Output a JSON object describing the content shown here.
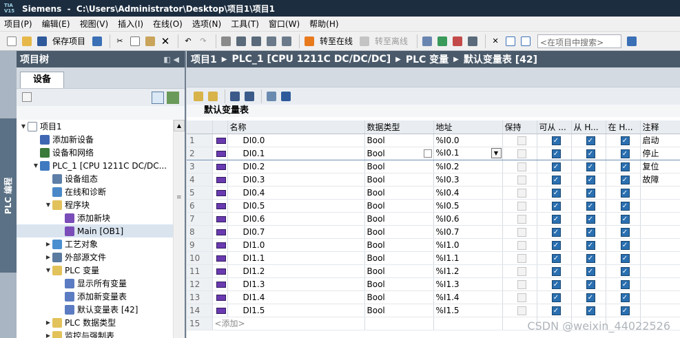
{
  "window": {
    "logo": "TIA\nV15",
    "title": "Siemens  -  C:\\Users\\Administrator\\Desktop\\项目1\\项目1"
  },
  "menu": [
    "项目(P)",
    "编辑(E)",
    "视图(V)",
    "插入(I)",
    "在线(O)",
    "选项(N)",
    "工具(T)",
    "窗口(W)",
    "帮助(H)"
  ],
  "toolbar": {
    "save_project": "保存项目",
    "go_online": "转至在线",
    "go_offline": "转至离线",
    "search_placeholder": "<在项目中搜索>"
  },
  "sidetab_label": "PLC 编程",
  "project_tree": {
    "title": "项目树",
    "device_tab": "设备",
    "items": [
      {
        "label": "项目1",
        "level": 0,
        "expander": "open",
        "icon": "project-icon",
        "color": "#ffffff"
      },
      {
        "label": "添加新设备",
        "level": 1,
        "expander": "",
        "icon": "add-device-icon",
        "color": "#3e66b3"
      },
      {
        "label": "设备和网络",
        "level": 1,
        "expander": "",
        "icon": "network-icon",
        "color": "#3a7a3a"
      },
      {
        "label": "PLC_1 [CPU 1211C DC/DC...",
        "level": 1,
        "expander": "open",
        "icon": "plc-icon",
        "color": "#3f7ac0"
      },
      {
        "label": "设备组态",
        "level": 2,
        "expander": "",
        "icon": "device-config-icon",
        "color": "#5d7ea6"
      },
      {
        "label": "在线和诊断",
        "level": 2,
        "expander": "",
        "icon": "diagnostics-icon",
        "color": "#4a88c7"
      },
      {
        "label": "程序块",
        "level": 2,
        "expander": "open",
        "icon": "folder-icon",
        "color": "#e2c25a"
      },
      {
        "label": "添加新块",
        "level": 3,
        "expander": "",
        "icon": "add-block-icon",
        "color": "#7a4db8"
      },
      {
        "label": "Main [OB1]",
        "level": 3,
        "expander": "",
        "icon": "ob-block-icon",
        "color": "#7a4db8"
      },
      {
        "label": "工艺对象",
        "level": 2,
        "expander": "closed",
        "icon": "technology-object-icon",
        "color": "#4b8fd0"
      },
      {
        "label": "外部源文件",
        "level": 2,
        "expander": "closed",
        "icon": "external-source-icon",
        "color": "#5a7aa0"
      },
      {
        "label": "PLC 变量",
        "level": 2,
        "expander": "open",
        "icon": "plc-tags-folder-icon",
        "color": "#e2c25a"
      },
      {
        "label": "显示所有变量",
        "level": 3,
        "expander": "",
        "icon": "tag-table-icon",
        "color": "#5b7cc2"
      },
      {
        "label": "添加新变量表",
        "level": 3,
        "expander": "",
        "icon": "add-tag-table-icon",
        "color": "#5b7cc2"
      },
      {
        "label": "默认变量表 [42]",
        "level": 3,
        "expander": "",
        "icon": "tag-table-icon",
        "color": "#5b7cc2"
      },
      {
        "label": "PLC 数据类型",
        "level": 2,
        "expander": "closed",
        "icon": "datatype-folder-icon",
        "color": "#e2c25a"
      },
      {
        "label": "监控与强制表",
        "level": 2,
        "expander": "closed",
        "icon": "watch-table-folder-icon",
        "color": "#e2c25a"
      }
    ]
  },
  "breadcrumb": [
    "项目1",
    "PLC_1 [CPU 1211C DC/DC/DC]",
    "PLC 变量",
    "默认变量表 [42]"
  ],
  "tag_table": {
    "title": "默认变量表",
    "columns": [
      "",
      "",
      "名称",
      "数据类型",
      "地址",
      "保持",
      "可从 ...",
      "从 H...",
      "在 H...",
      "注释"
    ],
    "rows": [
      {
        "n": "1",
        "name": "DI0.0",
        "type": "Bool",
        "addr": "%I0.0",
        "retain": false,
        "access": true,
        "write": true,
        "visible": true,
        "comment": "启动"
      },
      {
        "n": "2",
        "name": "DI0.1",
        "type": "Bool",
        "addr": "%I0.1",
        "retain": false,
        "access": true,
        "write": true,
        "visible": true,
        "comment": "停止"
      },
      {
        "n": "3",
        "name": "DI0.2",
        "type": "Bool",
        "addr": "%I0.2",
        "retain": false,
        "access": true,
        "write": true,
        "visible": true,
        "comment": "复位"
      },
      {
        "n": "4",
        "name": "DI0.3",
        "type": "Bool",
        "addr": "%I0.3",
        "retain": false,
        "access": true,
        "write": true,
        "visible": true,
        "comment": "故障"
      },
      {
        "n": "5",
        "name": "DI0.4",
        "type": "Bool",
        "addr": "%I0.4",
        "retain": false,
        "access": true,
        "write": true,
        "visible": true,
        "comment": ""
      },
      {
        "n": "6",
        "name": "DI0.5",
        "type": "Bool",
        "addr": "%I0.5",
        "retain": false,
        "access": true,
        "write": true,
        "visible": true,
        "comment": ""
      },
      {
        "n": "7",
        "name": "DI0.6",
        "type": "Bool",
        "addr": "%I0.6",
        "retain": false,
        "access": true,
        "write": true,
        "visible": true,
        "comment": ""
      },
      {
        "n": "8",
        "name": "DI0.7",
        "type": "Bool",
        "addr": "%I0.7",
        "retain": false,
        "access": true,
        "write": true,
        "visible": true,
        "comment": ""
      },
      {
        "n": "9",
        "name": "DI1.0",
        "type": "Bool",
        "addr": "%I1.0",
        "retain": false,
        "access": true,
        "write": true,
        "visible": true,
        "comment": ""
      },
      {
        "n": "10",
        "name": "DI1.1",
        "type": "Bool",
        "addr": "%I1.1",
        "retain": false,
        "access": true,
        "write": true,
        "visible": true,
        "comment": ""
      },
      {
        "n": "11",
        "name": "DI1.2",
        "type": "Bool",
        "addr": "%I1.2",
        "retain": false,
        "access": true,
        "write": true,
        "visible": true,
        "comment": ""
      },
      {
        "n": "12",
        "name": "DI1.3",
        "type": "Bool",
        "addr": "%I1.3",
        "retain": false,
        "access": true,
        "write": true,
        "visible": true,
        "comment": ""
      },
      {
        "n": "13",
        "name": "DI1.4",
        "type": "Bool",
        "addr": "%I1.4",
        "retain": false,
        "access": true,
        "write": true,
        "visible": true,
        "comment": ""
      },
      {
        "n": "14",
        "name": "DI1.5",
        "type": "Bool",
        "addr": "%I1.5",
        "retain": false,
        "access": true,
        "write": true,
        "visible": true,
        "comment": ""
      }
    ],
    "add_row": {
      "n": "15",
      "label": "<添加>"
    },
    "selected_row": "2"
  },
  "watermark": "CSDN @weixin_44022526"
}
